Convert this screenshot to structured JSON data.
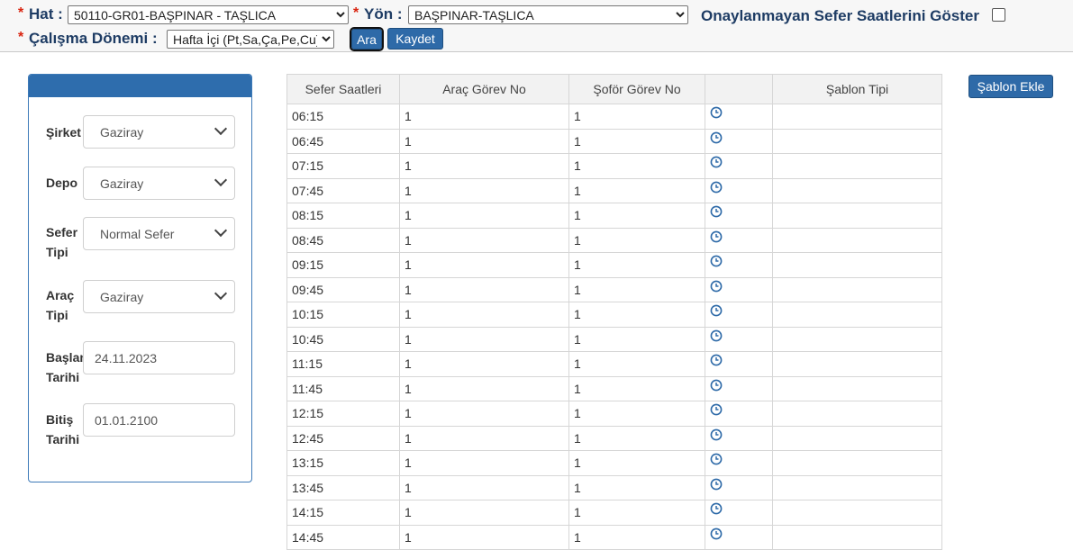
{
  "filters": {
    "hat_label": "Hat :",
    "hat_value": "50110-GR01-BAŞPINAR - TAŞLICA",
    "yon_label": "Yön :",
    "yon_value": "BAŞPINAR-TAŞLICA",
    "onay_label": "Onaylanmayan Sefer Saatlerini Göster",
    "donem_label": "Çalışma Dönemi :",
    "donem_value": "Hafta İçi (Pt,Sa,Ça,Pe,Cu)",
    "required_mark": "*",
    "ara_label": "Ara",
    "kaydet_label": "Kaydet"
  },
  "panel": {
    "sirket_label": "Şirket",
    "sirket_value": "Gaziray",
    "depo_label": "Depo",
    "depo_value": "Gaziray",
    "sefer_tipi_label1": "Sefer",
    "sefer_tipi_label2": "Tipi",
    "sefer_tipi_value": "Normal Sefer",
    "arac_tipi_label1": "Araç",
    "arac_tipi_label2": "Tipi",
    "arac_tipi_value": "Gaziray",
    "baslangic_label1": "Başlangıç",
    "baslangic_label2": "Tarihi",
    "baslangic_value": "24.11.2023",
    "bitis_label1": "Bitiş",
    "bitis_label2": "Tarihi",
    "bitis_value": "01.01.2100"
  },
  "sablon_ekle_label": "Şablon Ekle",
  "table": {
    "headers": [
      "Sefer Saatleri",
      "Araç Görev No",
      "Şoför Görev No",
      "",
      "Şablon Tipi"
    ],
    "rows": [
      {
        "saat": "06:15",
        "arac": "1",
        "sofor": "1",
        "tip": ""
      },
      {
        "saat": "06:45",
        "arac": "1",
        "sofor": "1",
        "tip": ""
      },
      {
        "saat": "07:15",
        "arac": "1",
        "sofor": "1",
        "tip": ""
      },
      {
        "saat": "07:45",
        "arac": "1",
        "sofor": "1",
        "tip": ""
      },
      {
        "saat": "08:15",
        "arac": "1",
        "sofor": "1",
        "tip": ""
      },
      {
        "saat": "08:45",
        "arac": "1",
        "sofor": "1",
        "tip": ""
      },
      {
        "saat": "09:15",
        "arac": "1",
        "sofor": "1",
        "tip": ""
      },
      {
        "saat": "09:45",
        "arac": "1",
        "sofor": "1",
        "tip": ""
      },
      {
        "saat": "10:15",
        "arac": "1",
        "sofor": "1",
        "tip": ""
      },
      {
        "saat": "10:45",
        "arac": "1",
        "sofor": "1",
        "tip": ""
      },
      {
        "saat": "11:15",
        "arac": "1",
        "sofor": "1",
        "tip": ""
      },
      {
        "saat": "11:45",
        "arac": "1",
        "sofor": "1",
        "tip": ""
      },
      {
        "saat": "12:15",
        "arac": "1",
        "sofor": "1",
        "tip": ""
      },
      {
        "saat": "12:45",
        "arac": "1",
        "sofor": "1",
        "tip": ""
      },
      {
        "saat": "13:15",
        "arac": "1",
        "sofor": "1",
        "tip": ""
      },
      {
        "saat": "13:45",
        "arac": "1",
        "sofor": "1",
        "tip": ""
      },
      {
        "saat": "14:15",
        "arac": "1",
        "sofor": "1",
        "tip": ""
      },
      {
        "saat": "14:45",
        "arac": "1",
        "sofor": "1",
        "tip": ""
      }
    ]
  },
  "icons": {
    "row_action": "clock-icon",
    "dropdown": "chevron-down-icon"
  },
  "colors": {
    "accent": "#2e6aa8",
    "label": "#1e3c64",
    "required": "#d9230f"
  }
}
